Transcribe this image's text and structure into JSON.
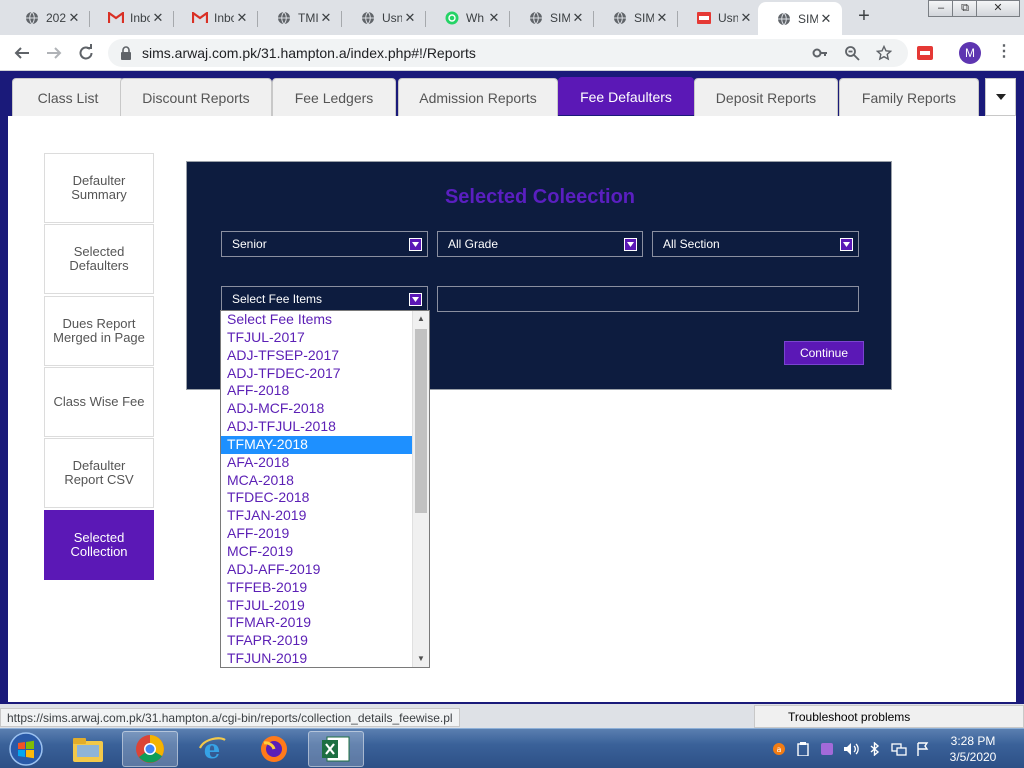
{
  "browser": {
    "tabs": [
      {
        "title": "202",
        "favicon": "globe"
      },
      {
        "title": "Inbc",
        "favicon": "gmail"
      },
      {
        "title": "Inbc",
        "favicon": "gmail"
      },
      {
        "title": "TMI",
        "favicon": "globe"
      },
      {
        "title": "Usn",
        "favicon": "globe"
      },
      {
        "title": "Wh",
        "favicon": "whatsapp"
      },
      {
        "title": "SIM",
        "favicon": "globe"
      },
      {
        "title": "SIM",
        "favicon": "globe"
      },
      {
        "title": "Usn",
        "favicon": "pdf"
      },
      {
        "title": "SIM",
        "favicon": "globe"
      }
    ],
    "url": "sims.arwaj.com.pk/31.hampton.a/index.php#!/Reports",
    "profile_initial": "M",
    "status_url": "https://sims.arwaj.com.pk/31.hampton.a/cgi-bin/reports/collection_details_feewise.pl",
    "troubleshoot": "Troubleshoot problems"
  },
  "nav": {
    "tabs": [
      "Class List",
      "Discount Reports",
      "Fee Ledgers",
      "Admission Reports",
      "Fee Defaulters",
      "Deposit Reports",
      "Family Reports"
    ],
    "active": "Fee Defaulters"
  },
  "sidebar": {
    "items": [
      "Defaulter Summary",
      "Selected Defaulters",
      "Dues Report Merged in Page",
      "Class Wise Fee",
      "Defaulter Report CSV",
      "Selected Collection"
    ],
    "active": "Selected Collection"
  },
  "panel": {
    "title": "Selected Coleection",
    "school_select": "Senior",
    "grade_select": "All Grade",
    "section_select": "All Section",
    "fee_select": "Select Fee Items",
    "continue_label": "Continue"
  },
  "dropdown": {
    "options": [
      "Select Fee Items",
      "TFJUL-2017",
      "ADJ-TFSEP-2017",
      "ADJ-TFDEC-2017",
      "AFF-2018",
      "ADJ-MCF-2018",
      "ADJ-TFJUL-2018",
      "TFMAY-2018",
      "AFA-2018",
      "MCA-2018",
      "TFDEC-2018",
      "TFJAN-2019",
      "AFF-2019",
      "MCF-2019",
      "ADJ-AFF-2019",
      "TFFEB-2019",
      "TFJUL-2019",
      "TFMAR-2019",
      "TFAPR-2019",
      "TFJUN-2019"
    ],
    "highlighted": "TFMAY-2018"
  },
  "taskbar": {
    "time": "3:28 PM",
    "date": "3/5/2020"
  },
  "colors": {
    "accent": "#5b18b6",
    "page_bg": "#1a1a7a",
    "panel_bg": "#0d1c3f",
    "highlight": "#1e90ff"
  }
}
